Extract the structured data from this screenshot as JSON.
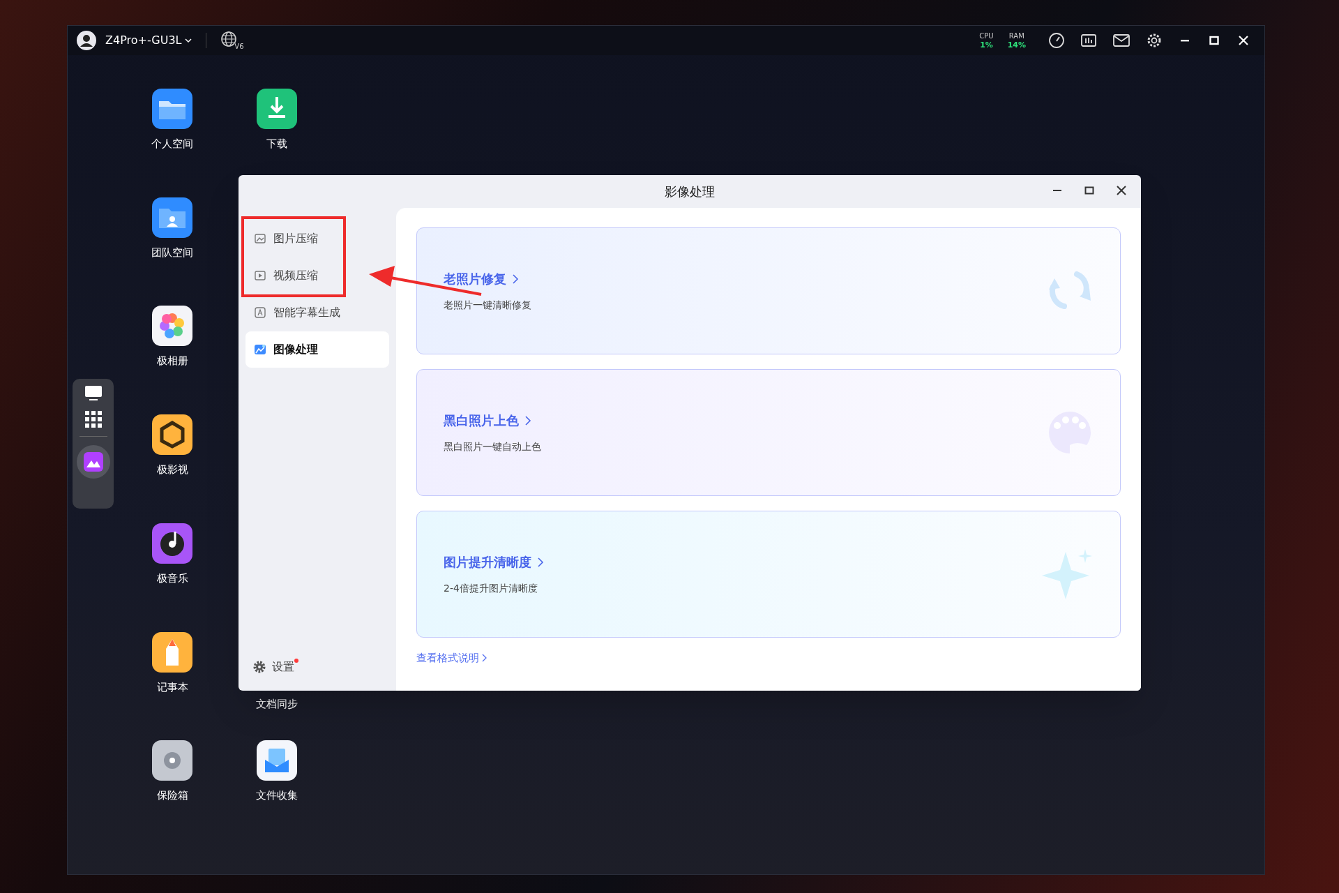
{
  "topbar": {
    "device": "Z4Pro+-GU3L",
    "network_badge": "V6",
    "cpu_label": "CPU",
    "cpu_value": "1%",
    "ram_label": "RAM",
    "ram_value": "14%"
  },
  "desktop_column_1": [
    {
      "label": "个人空间",
      "kind": "folder"
    },
    {
      "label": "团队空间",
      "kind": "team"
    },
    {
      "label": "极相册",
      "kind": "photos"
    },
    {
      "label": "极影视",
      "kind": "video"
    },
    {
      "label": "极音乐",
      "kind": "music"
    },
    {
      "label": "记事本",
      "kind": "notes"
    },
    {
      "label": "保险箱",
      "kind": "vault"
    }
  ],
  "desktop_column_2": [
    {
      "label": "下载",
      "kind": "download"
    },
    {
      "label": "文档同步",
      "kind": "covered"
    },
    {
      "label": "文件收集",
      "kind": "collect"
    }
  ],
  "window": {
    "title": "影像处理",
    "sidebar": [
      {
        "label": "图片压缩",
        "kind": "image",
        "selected": false
      },
      {
        "label": "视频压缩",
        "kind": "video",
        "selected": false
      },
      {
        "label": "智能字幕生成",
        "kind": "subtitle",
        "selected": false
      },
      {
        "label": "图像处理",
        "kind": "process",
        "selected": true
      }
    ],
    "settings": {
      "label": "设置",
      "badge": true
    },
    "cards": [
      {
        "title": "老照片修复",
        "description": "老照片一键清晰修复",
        "kind": "refresh"
      },
      {
        "title": "黑白照片上色",
        "description": "黑白照片一键自动上色",
        "kind": "palette"
      },
      {
        "title": "图片提升清晰度",
        "description": "2-4倍提升图片清晰度",
        "kind": "sparkle"
      }
    ],
    "footer_link": "查看格式说明"
  }
}
